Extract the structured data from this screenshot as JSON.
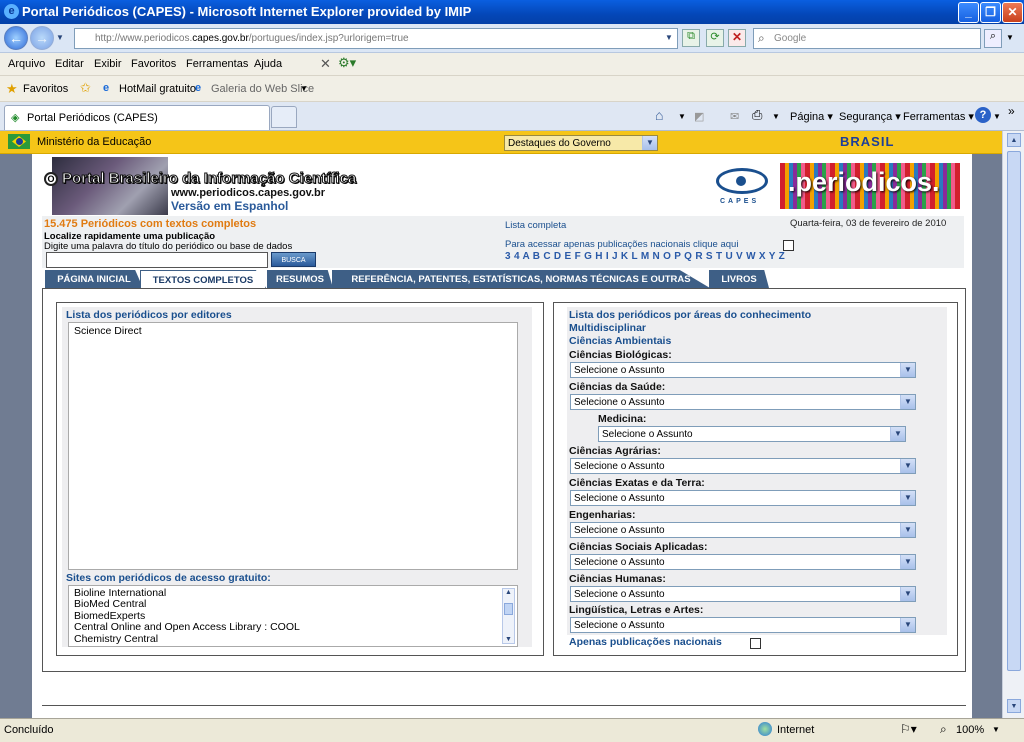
{
  "window": {
    "title": "Portal Periódicos (CAPES) - Microsoft Internet Explorer provided by IMIP"
  },
  "address": {
    "url_prefix": "http://www.periodicos.",
    "url_domain": "capes.gov.br",
    "url_suffix": "/portugues/index.jsp?urlorigem=true",
    "search_placeholder": "Google"
  },
  "menu": [
    "Arquivo",
    "Editar",
    "Exibir",
    "Favoritos",
    "Ferramentas",
    "Ajuda"
  ],
  "favorites": {
    "label": "Favoritos",
    "items": [
      "HotMail gratuito",
      "Galeria do Web Slice"
    ]
  },
  "tab": {
    "title": "Portal Periódicos (CAPES)"
  },
  "commands": {
    "pagina": "Página",
    "seguranca": "Segurança",
    "ferramentas": "Ferramentas"
  },
  "gov": {
    "ministry": "Ministério da Educação",
    "dropdown": "Destaques do Governo",
    "brand": "BRASIL"
  },
  "header": {
    "portal_title": "Portal Brasileiro da Informação Científica",
    "portal_url": "www.periodicos.capes.gov.br",
    "spanish": "Versão em Espanhol",
    "capes": "CAPES",
    "periodicos_logo": ".periodicos."
  },
  "info": {
    "count": "15.475 Periódicos com textos completos",
    "quick": "Localize rapidamente uma publicação",
    "hint": "Digite uma palavra do título do periódico ou base de dados",
    "search_btn": "BUSCA",
    "lista_completa": "Lista completa",
    "nacionais_hint": "Para acessar apenas publicações nacionais clique aqui",
    "date": "Quarta-feira, 03 de fevereiro de 2010",
    "alphabet": "3 4 A B C D E F G H I J K L M N O P Q R S T U V W X Y Z"
  },
  "navtabs": [
    "PÁGINA INICIAL",
    "TEXTOS COMPLETOS",
    "RESUMOS",
    "REFERÊNCIA, PATENTES, ESTATÍSTICAS, NORMAS TÉCNICAS E OUTRAS",
    "LIVROS"
  ],
  "left": {
    "editores_title": "Lista dos periódicos por editores",
    "editores": [
      "Science Direct"
    ],
    "gratuitos_title": "Sites com periódicos de acesso gratuito:",
    "gratuitos": [
      "Bioline International",
      "BioMed Central",
      "BiomedExperts",
      "Central Online and Open Access Library : COOL",
      "Chemistry Central"
    ]
  },
  "right": {
    "title": "Lista dos periódicos por áreas do conhecimento",
    "links": [
      "Multidisciplinar",
      "Ciências Ambientais"
    ],
    "select_placeholder": "Selecione o Assunto",
    "areas": [
      "Ciências Biológicas:",
      "Ciências da Saúde:",
      "Medicina:",
      "Ciências Agrárias:",
      "Ciências Exatas e da Terra:",
      "Engenharias:",
      "Ciências Sociais Aplicadas:",
      "Ciências Humanas:",
      "Lingüística, Letras e Artes:"
    ],
    "nacionais": "Apenas publicações nacionais"
  },
  "status": {
    "left": "Concluído",
    "zone": "Internet",
    "zoom": "100%"
  }
}
